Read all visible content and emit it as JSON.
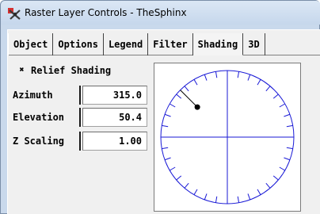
{
  "window": {
    "title": "Raster Layer Controls - TheSphinx"
  },
  "tabs": [
    {
      "label": "Object",
      "active": false
    },
    {
      "label": "Options",
      "active": false
    },
    {
      "label": "Legend",
      "active": false
    },
    {
      "label": "Filter",
      "active": false
    },
    {
      "label": "Shading",
      "active": true
    },
    {
      "label": "3D",
      "active": false
    }
  ],
  "relief_shading": {
    "label": "Relief Shading",
    "checked": true,
    "check_mark": "✖"
  },
  "fields": {
    "azimuth": {
      "label": "Azimuth",
      "value": "315.0"
    },
    "elevation": {
      "label": "Elevation",
      "value": "50.4"
    },
    "z_scaling": {
      "label": "Z Scaling",
      "value": "1.00"
    }
  },
  "dial": {
    "azimuth_deg": 315,
    "elevation_deg": 50.4,
    "tick_count": 36,
    "color": "#1a1ad6",
    "indicator_color": "#000000"
  },
  "colors": {
    "titlebar": "#c9d9ec",
    "panel": "#f0f0f0",
    "dial_stroke": "#1a1ad6"
  },
  "icons": {
    "app": "layer-controls-icon"
  }
}
